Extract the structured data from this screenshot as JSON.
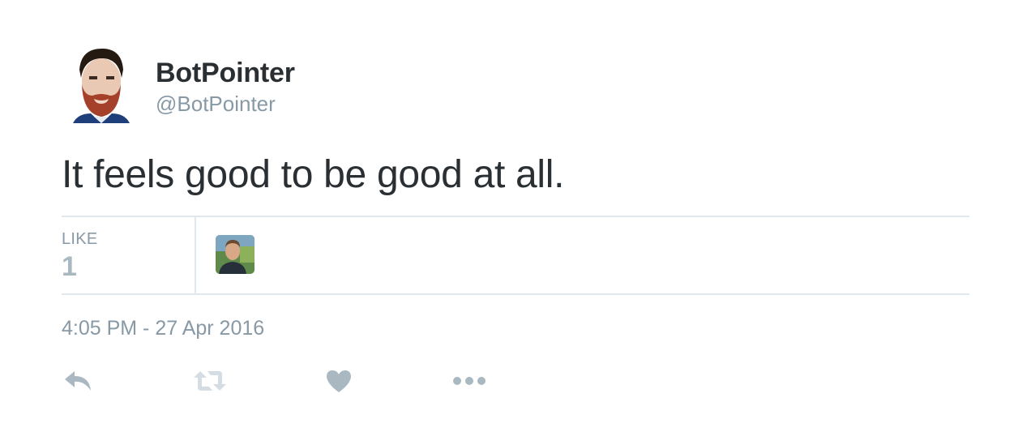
{
  "user": {
    "display_name": "BotPointer",
    "screen_name": "@BotPointer"
  },
  "tweet": {
    "text": "It feels good to be good at all.",
    "timestamp": "4:05 PM - 27 Apr 2016"
  },
  "stats": {
    "like_label": "LIKE",
    "like_count": "1"
  },
  "actions": {
    "reply_icon": "reply-icon",
    "retweet_icon": "retweet-icon",
    "like_icon": "heart-icon",
    "more_icon": "more-dots-icon"
  },
  "colors": {
    "text": "#292f33",
    "muted": "#8899a6",
    "icon": "#aab8c2",
    "divider": "#e1e8ed"
  }
}
